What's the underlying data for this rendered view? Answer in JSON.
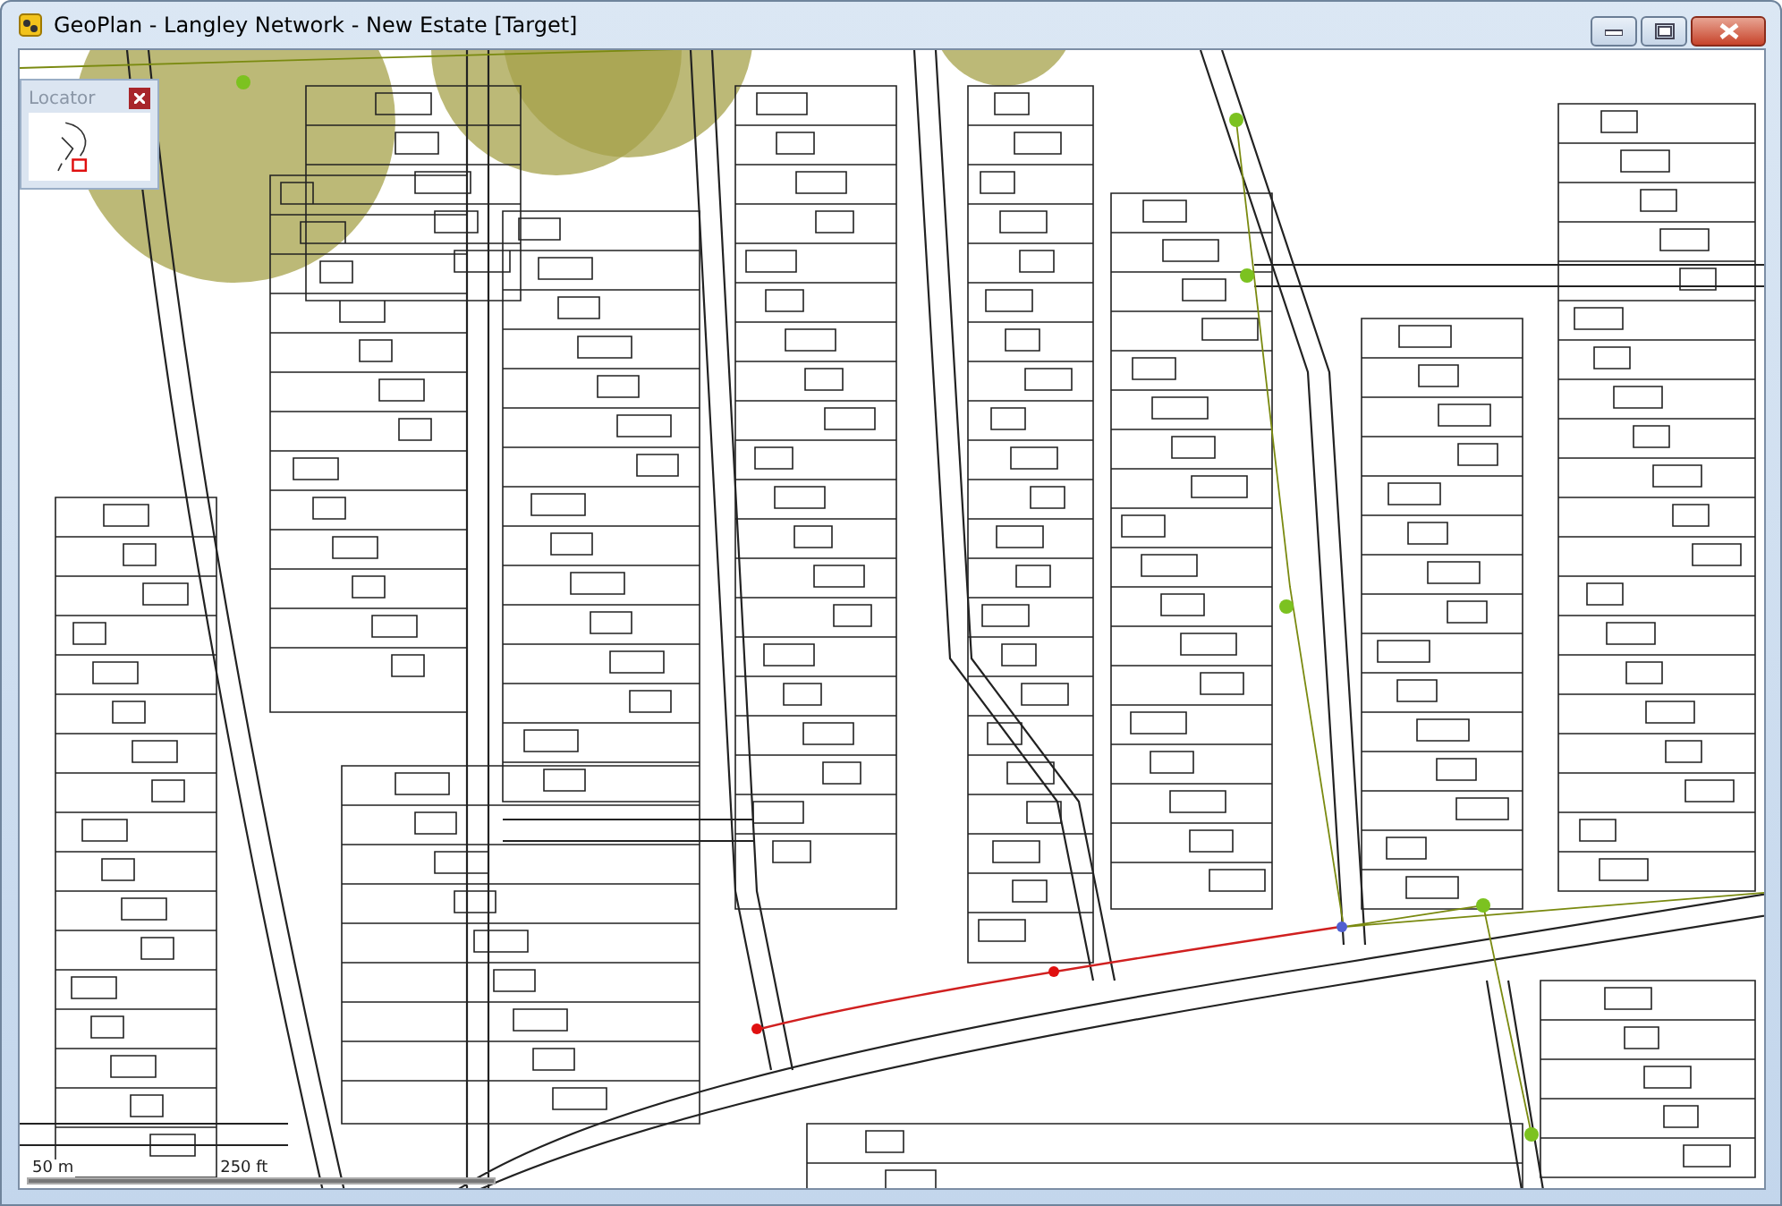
{
  "window": {
    "title": "GeoPlan - Langley Network - New Estate [Target]"
  },
  "locator": {
    "title": "Locator"
  },
  "scale_bar": {
    "metric": "50 m",
    "imperial": "250 ft"
  }
}
